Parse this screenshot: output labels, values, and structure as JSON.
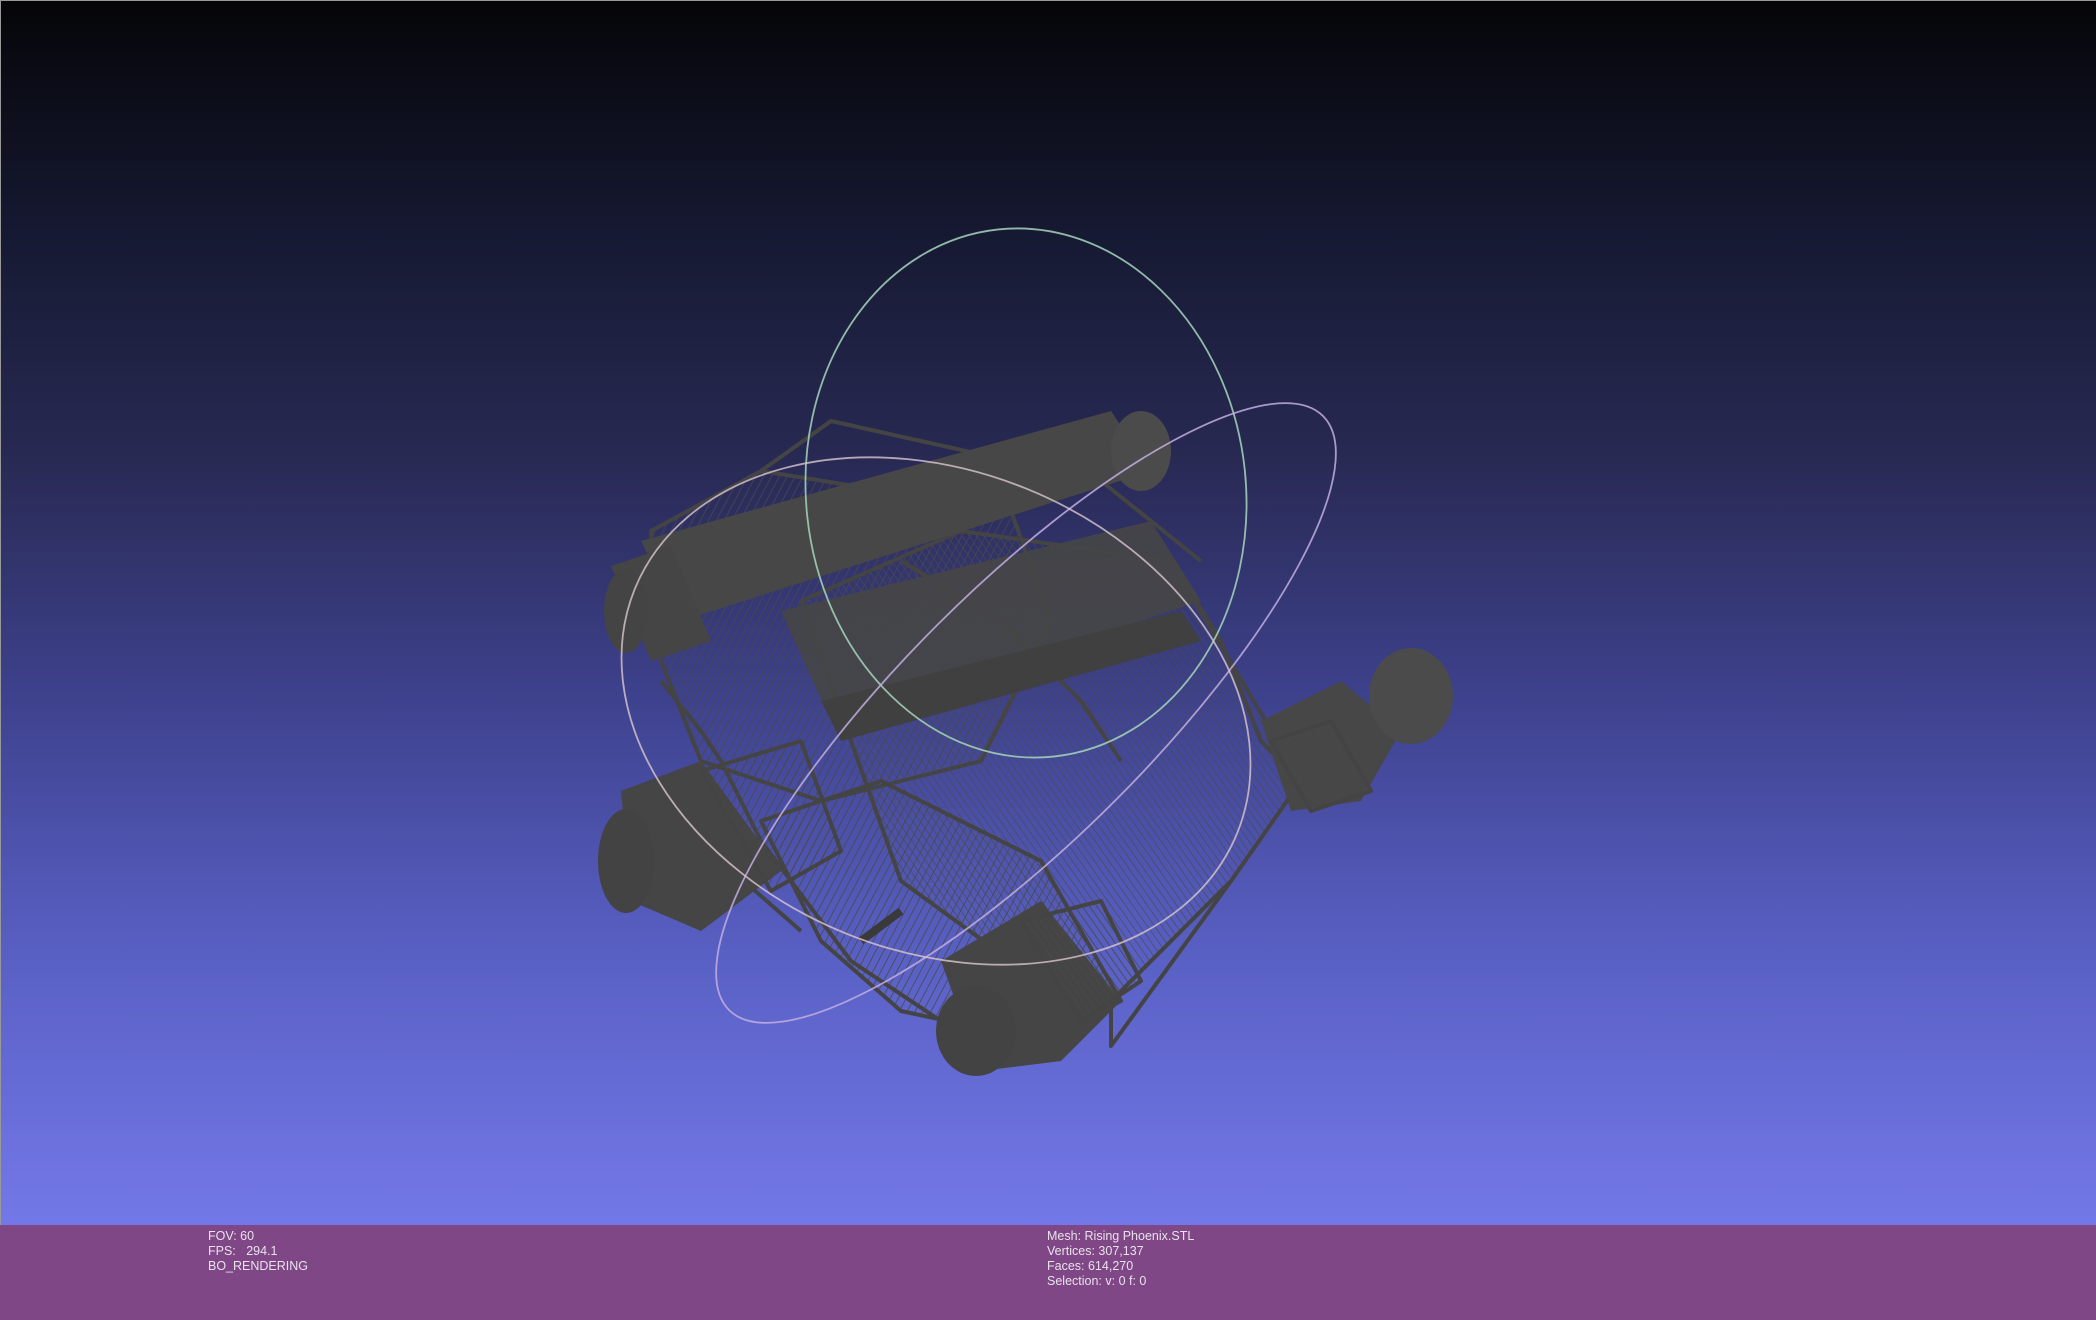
{
  "viewport": {
    "gradient_top": "#050508",
    "gradient_bottom": "#7378e8",
    "mesh_color": "#464646",
    "trackball_colors": [
      "#9fd4b4",
      "#b9a4d8",
      "#d8c0c8"
    ]
  },
  "info_left": {
    "fov": "FOV: 60",
    "fps": "FPS:   294.1",
    "mode": "BO_RENDERING"
  },
  "info_right": {
    "mesh": "Mesh: Rising Phoenix.STL",
    "vertices": "Vertices: 307,137",
    "faces": "Faces: 614,270",
    "selection": "Selection: v: 0 f: 0"
  },
  "infobar_color": "#7f4785"
}
